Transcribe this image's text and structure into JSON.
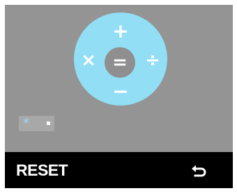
{
  "colors": {
    "background": "#949494",
    "dial": "#91def5",
    "dial_center": "#8f8f8f",
    "bottom_bar": "#000000",
    "text": "#ffffff"
  },
  "dial": {
    "top": "+",
    "bottom": "−",
    "left": "×",
    "right": "÷",
    "center": "="
  },
  "expression": {
    "operator": "*"
  },
  "bottom_bar": {
    "reset_label": "RESET",
    "undo_icon": "undo-arrow-icon"
  }
}
